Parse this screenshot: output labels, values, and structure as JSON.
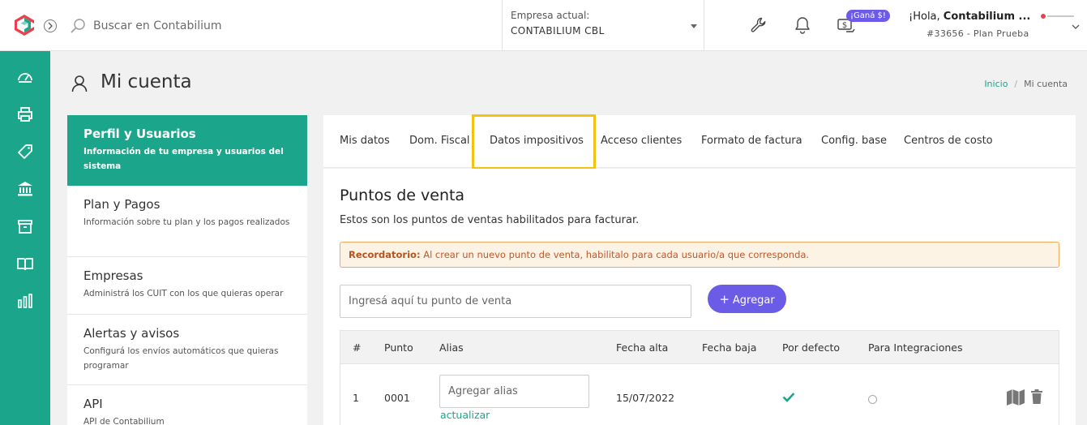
{
  "topbar": {
    "search_placeholder": "Buscar en Contabilium",
    "company_label": "Empresa actual:",
    "company_name": "CONTABILIUM CBL",
    "promo_badge": "¡Ganá $!",
    "greeting_prefix": "¡Hola, ",
    "greeting_name": "Contabilium ...",
    "account_plan": "#33656 - Plan Prueba"
  },
  "leftnav": {
    "icons": [
      "dashboard-icon",
      "printer-icon",
      "tag-icon",
      "bank-icon",
      "box-icon",
      "book-icon",
      "bar-chart-icon"
    ]
  },
  "page": {
    "title": "Mi cuenta",
    "breadcrumb": {
      "home": "Inicio",
      "separator": "/",
      "current": "Mi cuenta"
    }
  },
  "menu": [
    {
      "title": "Perfil y Usuarios",
      "desc": "Información de tu empresa y usuarios del sistema",
      "active": true
    },
    {
      "title": "Plan y Pagos",
      "desc": "Información sobre tu plan y los pagos realizados",
      "active": false
    },
    {
      "title": "Empresas",
      "desc": "Administrá los CUIT con los que quieras operar",
      "active": false
    },
    {
      "title": "Alertas y avisos",
      "desc": "Configurá los envíos automáticos que quieras programar",
      "active": false
    },
    {
      "title": "API",
      "desc": "API de Contabilium",
      "active": false
    }
  ],
  "tabs": [
    "Mis datos",
    "Dom. Fiscal",
    "Datos impositivos",
    "Acceso clientes",
    "Formato de factura",
    "Config. base",
    "Centros de costo"
  ],
  "section": {
    "title": "Puntos de venta",
    "subtitle": "Estos son los puntos de ventas habilitados para facturar.",
    "alert_label": "Recordatorio:",
    "alert_text": " Al crear un nuevo punto de venta, habilitalo para cada usuario/a que corresponda.",
    "input_placeholder": "Ingresá aquí tu punto de venta",
    "add_button": "Agregar"
  },
  "table": {
    "headers": [
      "#",
      "Punto",
      "Alias",
      "Fecha alta",
      "Fecha baja",
      "Por defecto",
      "Para Integraciones"
    ],
    "rows": [
      {
        "num": "1",
        "punto": "0001",
        "alias_placeholder": "Agregar alias",
        "update": "actualizar",
        "fecha_alta": "15/07/2022",
        "fecha_baja": "",
        "por_defecto": true,
        "para_integraciones": false
      }
    ]
  },
  "colors": {
    "brand_green": "#1ba68b",
    "accent_purple": "#6b5ce7",
    "highlight": "#f3c313"
  }
}
